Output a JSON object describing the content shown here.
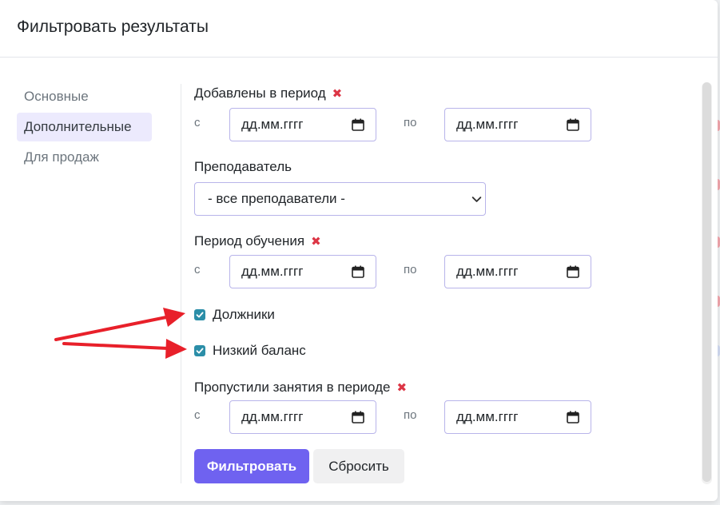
{
  "modal": {
    "title": "Фильтровать результаты"
  },
  "nav": {
    "items": [
      {
        "label": "Основные",
        "active": false
      },
      {
        "label": "Дополнительные",
        "active": true
      },
      {
        "label": "Для продаж",
        "active": false
      }
    ]
  },
  "filters": {
    "added_period": {
      "label": "Добавлены в период",
      "from_label": "с",
      "to_label": "по",
      "from_placeholder": "дд.мм.гггг",
      "to_placeholder": "дд.мм.гггг"
    },
    "teacher": {
      "label": "Преподаватель",
      "selected": "- все преподаватели -"
    },
    "study_period": {
      "label": "Период обучения",
      "from_label": "с",
      "to_label": "по",
      "from_placeholder": "дд.мм.гггг",
      "to_placeholder": "дд.мм.гггг"
    },
    "debtors": {
      "label": "Должники",
      "checked": true
    },
    "low_balance": {
      "label": "Низкий баланс",
      "checked": true
    },
    "missed_period": {
      "label": "Пропустили занятия в периоде",
      "from_label": "с",
      "to_label": "по",
      "from_placeholder": "дд.мм.гггг",
      "to_placeholder": "дд.мм.гггг"
    }
  },
  "actions": {
    "filter_label": "Фильтровать",
    "reset_label": "Сбросить"
  },
  "icons": {
    "clear": "close-x-icon",
    "date": "calendar-icon",
    "select": "chevron-down-icon",
    "check": "checkmark-icon"
  },
  "colors": {
    "primary": "#6f62f0",
    "clear_x": "#dc3545",
    "checkbox": "#2b8ea8",
    "input_border": "#b8b4ea",
    "nav_active_bg": "#eceafd",
    "annotation_arrow": "#e8202a"
  }
}
